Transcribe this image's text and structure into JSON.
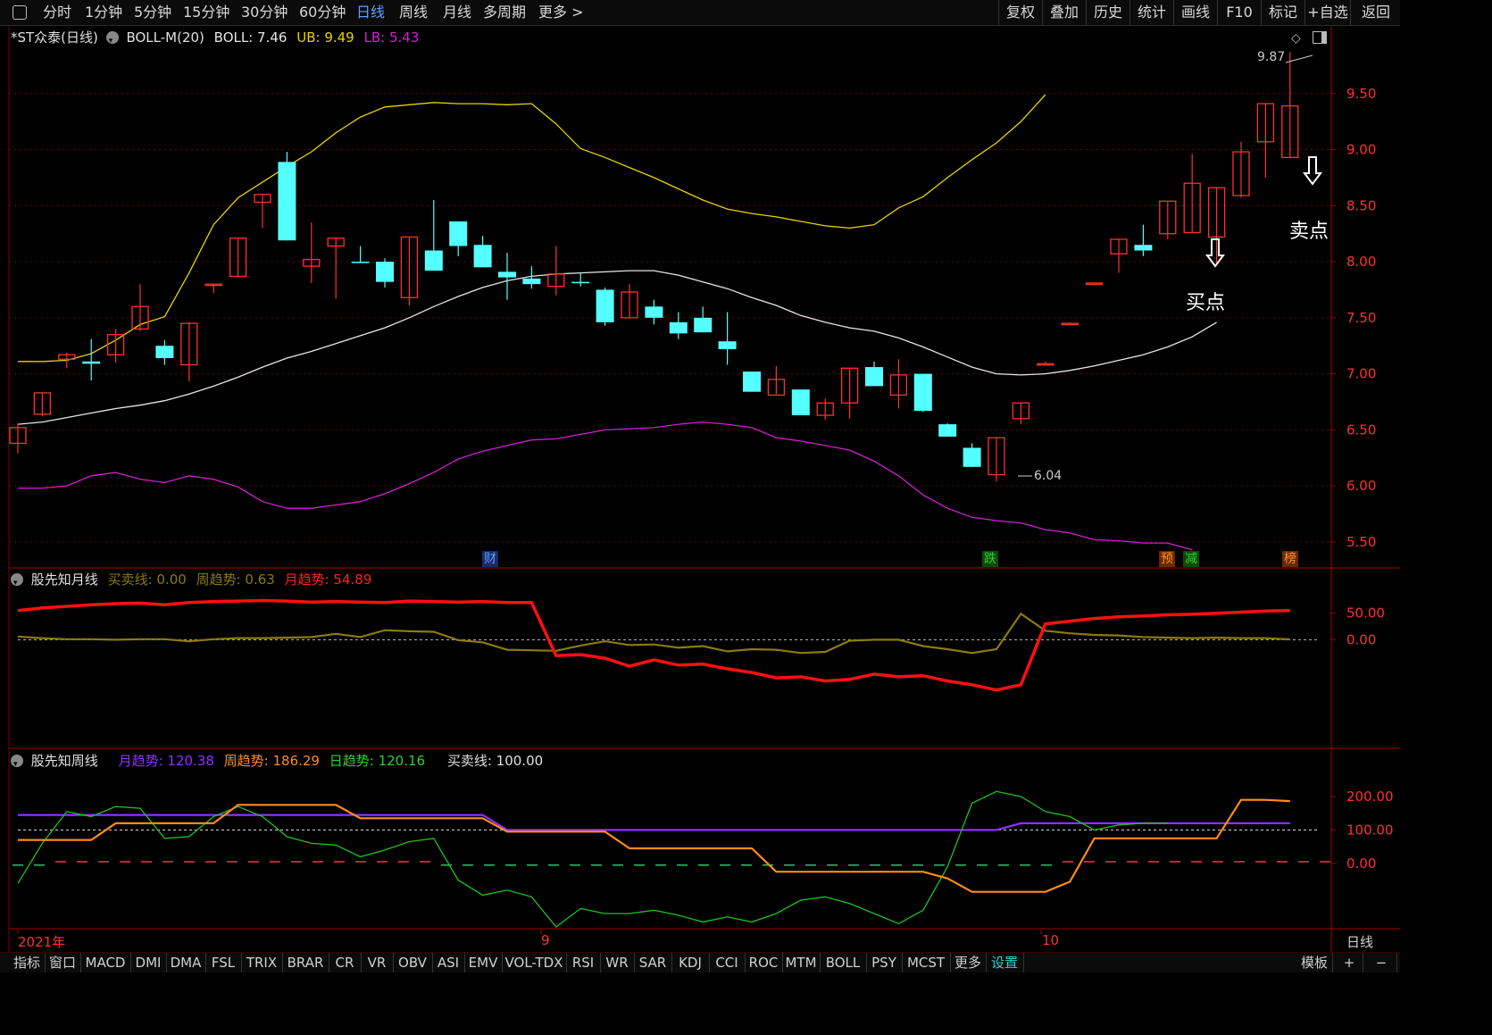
{
  "toolbar": {
    "left_items": [
      "分时",
      "1分钟",
      "5分钟",
      "15分钟",
      "30分钟",
      "60分钟",
      "日线",
      "周线",
      "月线",
      "多周期",
      "更多 >"
    ],
    "active_index": 6,
    "right_items": [
      "复权",
      "叠加",
      "历史",
      "统计",
      "画线",
      "F10",
      "标记",
      "+自选",
      "返回"
    ]
  },
  "main_panel": {
    "stock_name": "*ST众泰(日线)",
    "indicator": "BOLL-M(20)",
    "boll_label": "BOLL: 7.46",
    "ub_label": "UB: 9.49",
    "lb_label": "LB: 5.43",
    "colors": {
      "up": "#ff3030",
      "down": "#54ffff",
      "mid": "#e6e6e6",
      "ub": "#e6d200",
      "lb": "#d020d0"
    },
    "high_label": "9.87",
    "low_label": "6.04",
    "buy_label": "买点",
    "sell_label": "卖点",
    "badges": [
      {
        "text": "财",
        "color": "#5aa0ff",
        "bg": "#1a2a66"
      },
      {
        "text": "跌",
        "color": "#30d030",
        "bg": "#0a4a0a"
      },
      {
        "text": "预",
        "color": "#ff9030",
        "bg": "#6a2a00"
      },
      {
        "text": "减",
        "color": "#30d030",
        "bg": "#0a4a0a"
      },
      {
        "text": "榜",
        "color": "#ff9030",
        "bg": "#6a2a00"
      }
    ]
  },
  "panel2": {
    "title": "股先知月线",
    "l1": "买卖线: 0.00",
    "l2": "周趋势: 0.63",
    "l3": "月趋势: 54.89"
  },
  "panel3": {
    "title": "股先知周线",
    "l1": "月趋势: 120.38",
    "l2": "周趋势: 186.29",
    "l3": "日趋势: 120.16",
    "l4": "买卖线: 100.00"
  },
  "xaxis": {
    "labels": [
      "2021年",
      "9",
      "10"
    ],
    "period": "日线"
  },
  "bottom_tabs": [
    "指标",
    "窗口",
    "MACD",
    "DMI",
    "DMA",
    "FSL",
    "TRIX",
    "BRAR",
    "CR",
    "VR",
    "OBV",
    "ASI",
    "EMV",
    "VOL-TDX",
    "RSI",
    "WR",
    "SAR",
    "KDJ",
    "CCI",
    "ROC",
    "MTM",
    "BOLL",
    "PSY",
    "MCST",
    "更多",
    "设置"
  ],
  "bottom_right": [
    "模板",
    "+",
    "−"
  ],
  "chart_data": [
    {
      "type": "candlestick",
      "title": "*ST众泰(日线) BOLL-M(20)",
      "ylim": [
        5.3,
        10.0
      ],
      "yticks": [
        5.5,
        6.0,
        6.5,
        7.0,
        7.5,
        8.0,
        8.5,
        9.0,
        9.5
      ],
      "candles": [
        [
          6.38,
          6.52,
          6.56,
          6.29
        ],
        [
          6.64,
          6.83,
          6.83,
          6.62
        ],
        [
          7.13,
          7.17,
          7.19,
          7.05
        ],
        [
          7.11,
          7.09,
          7.31,
          6.94
        ],
        [
          7.17,
          7.35,
          7.4,
          7.1
        ],
        [
          7.4,
          7.6,
          7.8,
          7.38
        ],
        [
          7.25,
          7.14,
          7.3,
          7.08
        ],
        [
          7.08,
          7.45,
          7.46,
          6.93
        ],
        [
          7.8,
          7.8,
          7.8,
          7.72
        ],
        [
          7.87,
          8.21,
          8.21,
          7.87
        ],
        [
          8.53,
          8.6,
          8.6,
          8.3
        ],
        [
          8.89,
          8.19,
          8.98,
          8.19
        ],
        [
          7.96,
          8.02,
          8.35,
          7.81
        ],
        [
          8.14,
          8.21,
          8.21,
          7.67
        ],
        [
          8.0,
          7.99,
          8.14,
          7.99
        ],
        [
          8.0,
          7.82,
          8.03,
          7.77
        ],
        [
          7.68,
          8.22,
          8.22,
          7.61
        ],
        [
          8.1,
          7.92,
          8.55,
          7.92
        ],
        [
          8.36,
          8.14,
          8.36,
          8.05
        ],
        [
          8.15,
          7.95,
          8.23,
          7.95
        ],
        [
          7.91,
          7.86,
          8.08,
          7.66
        ],
        [
          7.85,
          7.8,
          7.96,
          7.76
        ],
        [
          7.78,
          7.89,
          8.14,
          7.7
        ],
        [
          7.82,
          7.81,
          7.9,
          7.78
        ],
        [
          7.75,
          7.46,
          7.77,
          7.43
        ],
        [
          7.5,
          7.73,
          7.8,
          7.5
        ],
        [
          7.6,
          7.5,
          7.66,
          7.44
        ],
        [
          7.46,
          7.36,
          7.55,
          7.31
        ],
        [
          7.5,
          7.37,
          7.6,
          7.37
        ],
        [
          7.29,
          7.22,
          7.55,
          7.08
        ],
        [
          7.02,
          6.84,
          7.02,
          6.84
        ],
        [
          6.81,
          6.95,
          7.07,
          6.82
        ],
        [
          6.86,
          6.63,
          6.86,
          6.63
        ],
        [
          6.63,
          6.74,
          6.78,
          6.59
        ],
        [
          6.74,
          7.05,
          7.05,
          6.6
        ],
        [
          7.06,
          6.89,
          7.11,
          6.89
        ],
        [
          6.81,
          6.99,
          7.13,
          6.69
        ],
        [
          7.0,
          6.67,
          7.0,
          6.66
        ],
        [
          6.55,
          6.44,
          6.56,
          6.44
        ],
        [
          6.34,
          6.17,
          6.38,
          6.17
        ],
        [
          6.1,
          6.43,
          6.43,
          6.04
        ],
        [
          6.6,
          6.74,
          6.74,
          6.55
        ],
        [
          7.09,
          7.09,
          7.11,
          7.09
        ],
        [
          7.45,
          7.45,
          7.46,
          7.45
        ],
        [
          7.81,
          7.81,
          7.81,
          7.81
        ],
        [
          8.07,
          8.2,
          8.2,
          7.9
        ],
        [
          8.15,
          8.1,
          8.33,
          8.05
        ],
        [
          8.25,
          8.54,
          8.54,
          8.2
        ],
        [
          8.26,
          8.7,
          8.96,
          8.26
        ],
        [
          8.22,
          8.66,
          8.66,
          7.99
        ],
        [
          8.59,
          8.98,
          9.07,
          8.57
        ],
        [
          9.07,
          9.41,
          9.41,
          8.75
        ],
        [
          8.93,
          9.39,
          9.87,
          8.93
        ]
      ],
      "mid": [
        6.55,
        6.57,
        6.61,
        6.65,
        6.69,
        6.72,
        6.76,
        6.82,
        6.89,
        6.97,
        7.06,
        7.14,
        7.2,
        7.27,
        7.34,
        7.41,
        7.5,
        7.6,
        7.69,
        7.77,
        7.83,
        7.87,
        7.89,
        7.9,
        7.91,
        7.92,
        7.92,
        7.88,
        7.82,
        7.76,
        7.68,
        7.61,
        7.52,
        7.46,
        7.41,
        7.38,
        7.32,
        7.24,
        7.15,
        7.06,
        7.0,
        6.99,
        7.0,
        7.03,
        7.07,
        7.12,
        7.17,
        7.24,
        7.33,
        7.46
      ],
      "ub": [
        7.11,
        7.11,
        7.12,
        7.18,
        7.3,
        7.44,
        7.51,
        7.9,
        8.33,
        8.57,
        8.71,
        8.85,
        8.98,
        9.15,
        9.29,
        9.38,
        9.4,
        9.42,
        9.41,
        9.41,
        9.4,
        9.41,
        9.23,
        9.01,
        8.93,
        8.84,
        8.75,
        8.65,
        8.55,
        8.47,
        8.43,
        8.4,
        8.36,
        8.32,
        8.3,
        8.33,
        8.48,
        8.58,
        8.75,
        8.91,
        9.06,
        9.25,
        9.49
      ],
      "lb": [
        5.98,
        5.98,
        6.0,
        6.09,
        6.12,
        6.06,
        6.03,
        6.09,
        6.06,
        5.99,
        5.86,
        5.8,
        5.8,
        5.83,
        5.86,
        5.93,
        6.02,
        6.12,
        6.24,
        6.31,
        6.36,
        6.41,
        6.42,
        6.46,
        6.5,
        6.51,
        6.52,
        6.55,
        6.57,
        6.55,
        6.52,
        6.43,
        6.4,
        6.36,
        6.32,
        6.22,
        6.09,
        5.92,
        5.8,
        5.72,
        5.69,
        5.67,
        5.61,
        5.58,
        5.52,
        5.51,
        5.49,
        5.49,
        5.43
      ]
    },
    {
      "type": "line",
      "title": "股先知月线",
      "ylim": [
        -200,
        95
      ],
      "yticks": [
        0.0,
        50.0
      ],
      "series": [
        {
          "name": "买卖线",
          "style": "dashed",
          "values": [
            0.0
          ]
        },
        {
          "name": "周趋势",
          "values": [
            6,
            3,
            1,
            1,
            0,
            1,
            1,
            -3,
            1,
            3,
            3,
            4,
            5,
            11,
            5,
            18,
            16,
            15,
            -1,
            -5,
            -19,
            -20,
            -21,
            -11,
            -3,
            -10,
            -9,
            -15,
            -12,
            -22,
            -18,
            -19,
            -25,
            -23,
            -2,
            0,
            0,
            -12,
            -18,
            -25,
            -18,
            49,
            17,
            12,
            9,
            8,
            5,
            4,
            3,
            4,
            3,
            3,
            0.63
          ]
        },
        {
          "name": "月趋势",
          "values": [
            55,
            60,
            63,
            66,
            68,
            69,
            66,
            70,
            72,
            73,
            74,
            73,
            71,
            72,
            71,
            70,
            73,
            72,
            71,
            72,
            70,
            70,
            -30,
            -28,
            -35,
            -50,
            -38,
            -48,
            -46,
            -55,
            -62,
            -72,
            -70,
            -78,
            -75,
            -65,
            -70,
            -68,
            -78,
            -85,
            -95,
            -85,
            30,
            35,
            40,
            43,
            45,
            47,
            48,
            50,
            52,
            54,
            54.89
          ]
        }
      ]
    },
    {
      "type": "line",
      "title": "股先知周线",
      "ylim": [
        -190,
        280
      ],
      "yticks": [
        0.0,
        100.0,
        200.0
      ],
      "series": [
        {
          "name": "月趋势",
          "values": [
            145,
            145,
            145,
            145,
            145,
            145,
            145,
            145,
            145,
            145,
            145,
            145,
            145,
            145,
            145,
            145,
            145,
            145,
            145,
            145,
            100,
            100,
            100,
            100,
            100,
            100,
            100,
            100,
            100,
            100,
            100,
            100,
            100,
            100,
            100,
            100,
            100,
            100,
            100,
            100,
            100,
            120,
            120,
            120,
            120,
            120,
            120,
            120,
            120,
            120,
            120,
            120,
            120.38
          ]
        },
        {
          "name": "周趋势",
          "values": [
            70,
            70,
            70,
            70,
            120,
            120,
            120,
            120,
            120,
            175,
            175,
            175,
            175,
            175,
            135,
            135,
            135,
            135,
            135,
            135,
            95,
            95,
            95,
            95,
            95,
            45,
            45,
            45,
            45,
            45,
            45,
            -25,
            -25,
            -25,
            -25,
            -25,
            -25,
            -25,
            -45,
            -85,
            -85,
            -85,
            -85,
            -55,
            75,
            75,
            75,
            75,
            75,
            75,
            190,
            190,
            186.29
          ]
        },
        {
          "name": "日趋势",
          "values": [
            -60,
            60,
            155,
            140,
            170,
            165,
            75,
            80,
            140,
            170,
            140,
            80,
            60,
            55,
            20,
            40,
            65,
            75,
            -50,
            -95,
            -80,
            -100,
            -190,
            -135,
            -150,
            -150,
            -140,
            -155,
            -175,
            -160,
            -175,
            -150,
            -110,
            -100,
            -120,
            -150,
            -180,
            -140,
            -10,
            180,
            215,
            200,
            155,
            140,
            100,
            115,
            120,
            120.16
          ]
        },
        {
          "name": "买卖线",
          "style": "dashed",
          "values": [
            100.0
          ]
        }
      ]
    }
  ]
}
